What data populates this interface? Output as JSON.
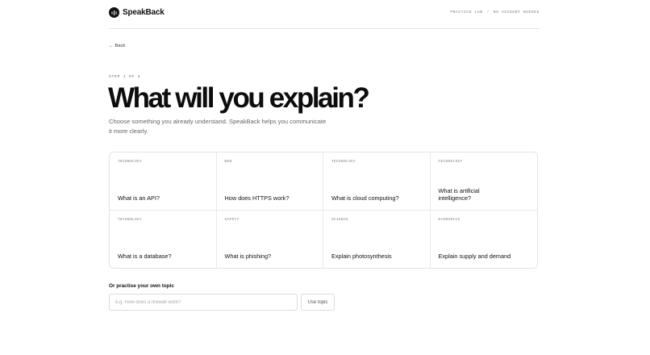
{
  "header": {
    "brand": "SpeakBack",
    "logo_icon": "waveform-icon",
    "tag_left": "PRACTICE LAB",
    "separator": "/",
    "tag_right": "NO ACCOUNT NEEDED"
  },
  "nav": {
    "back_label": "← Back"
  },
  "page": {
    "step": "STEP 1 OF 3",
    "title": "What will you explain?",
    "subtitle": "Choose something you already understand. SpeakBack helps you communicate it more clearly."
  },
  "topics": [
    {
      "category": "TECHNOLOGY",
      "title": "What is an API?"
    },
    {
      "category": "WEB",
      "title": "How does HTTPS work?"
    },
    {
      "category": "TECHNOLOGY",
      "title": "What is cloud computing?"
    },
    {
      "category": "TECHNOLOGY",
      "title": "What is artificial intelligence?"
    },
    {
      "category": "TECHNOLOGY",
      "title": "What is a database?"
    },
    {
      "category": "SAFETY",
      "title": "What is phishing?"
    },
    {
      "category": "SCIENCE",
      "title": "Explain photosynthesis"
    },
    {
      "category": "ECONOMICS",
      "title": "Explain supply and demand"
    }
  ],
  "custom": {
    "label": "Or practise your own topic",
    "placeholder": "e.g. How does a firewall work?",
    "value": "",
    "button_label": "Use topic"
  },
  "colors": {
    "text": "#111111",
    "muted": "#666666",
    "border": "#e3e3e3",
    "background": "#ffffff"
  }
}
